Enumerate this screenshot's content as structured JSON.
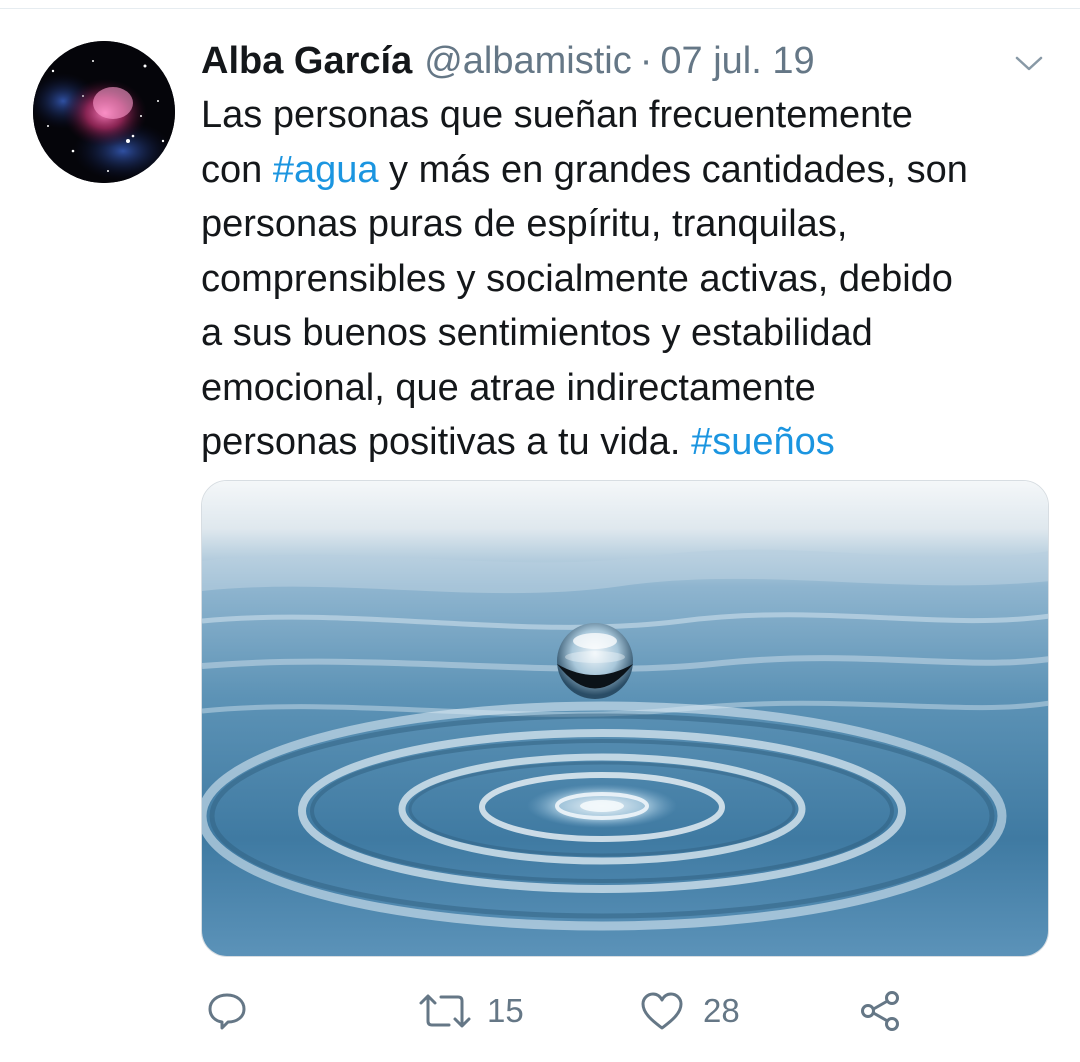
{
  "tweet": {
    "author": {
      "display_name": "Alba García",
      "handle": "@albamistic",
      "avatar_icon": "nebula-avatar"
    },
    "separator": "·",
    "date": "07 jul. 19",
    "text_lines": [
      [
        {
          "t": "Las personas que sueñan frecuentemente"
        }
      ],
      [
        {
          "t": "con "
        },
        {
          "t": "#agua",
          "hashtag": true
        },
        {
          "t": " y más en grandes cantidades, son"
        }
      ],
      [
        {
          "t": "personas puras de espíritu, tranquilas,"
        }
      ],
      [
        {
          "t": "comprensibles y socialmente activas, debido"
        }
      ],
      [
        {
          "t": "a sus buenos sentimientos y estabilidad"
        }
      ],
      [
        {
          "t": "emocional, que atrae indirectamente"
        }
      ],
      [
        {
          "t": "personas positivas a tu vida. "
        },
        {
          "t": "#sueños",
          "hashtag": true
        }
      ]
    ],
    "media": {
      "icon": "water-drop-image"
    },
    "actions": {
      "reply": {
        "icon": "reply-icon",
        "count": ""
      },
      "retweet": {
        "icon": "retweet-icon",
        "count": "15"
      },
      "like": {
        "icon": "heart-icon",
        "count": "28"
      },
      "share": {
        "icon": "share-icon",
        "count": ""
      }
    },
    "menu_icon": "chevron-down-icon"
  },
  "colors": {
    "text": "#14171a",
    "secondary": "#657786",
    "hashtag": "#1b95e0",
    "divider": "#e6ecf0"
  }
}
